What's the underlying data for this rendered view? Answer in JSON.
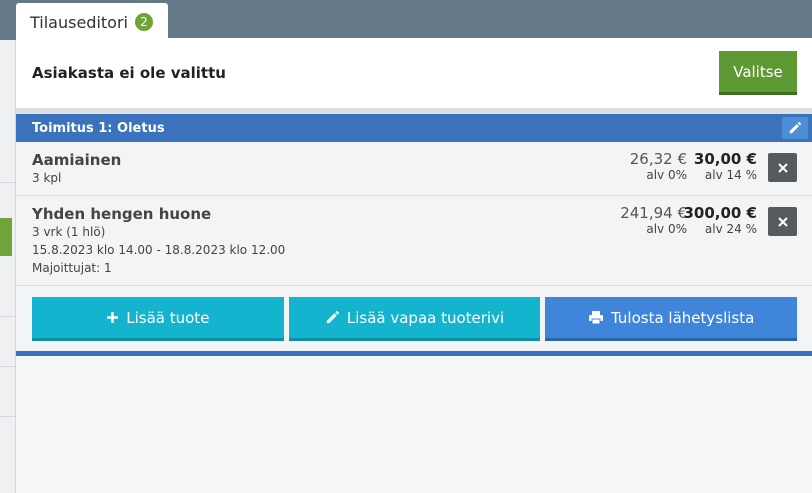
{
  "tab": {
    "label": "Tilauseditori",
    "badge": "2"
  },
  "customer": {
    "text": "Asiakasta ei ole valittu",
    "select_label": "Valitse"
  },
  "delivery": {
    "title": "Toimitus 1: Oletus"
  },
  "items": [
    {
      "name": "Aamiainen",
      "qty": "3 kpl",
      "price_excl": "26,32 €",
      "vat_excl": "alv 0%",
      "price_incl": "30,00 €",
      "vat_incl": "alv 14 %"
    },
    {
      "name": "Yhden hengen huone",
      "qty": "3 vrk (1 hlö)",
      "dates": "15.8.2023 klo 14.00 - 18.8.2023 klo 12.00",
      "guests": "Majoittujat: 1",
      "price_excl": "241,94 €",
      "vat_excl": "alv 0%",
      "price_incl": "300,00 €",
      "vat_incl": "alv 24 %"
    }
  ],
  "actions": {
    "add_product": "Lisää tuote",
    "add_free_row": "Lisää vapaa tuoterivi",
    "print_list": "Tulosta lähetyslista"
  },
  "colors": {
    "brand_green": "#5e9a33",
    "delivery_blue": "#3a72bd",
    "teal": "#14b4cf",
    "print_blue": "#3f86db"
  },
  "icons": {
    "edit": "pencil-icon",
    "delete": "close-icon",
    "add": "plus-icon",
    "free_row": "pencil-icon",
    "print": "printer-icon"
  }
}
